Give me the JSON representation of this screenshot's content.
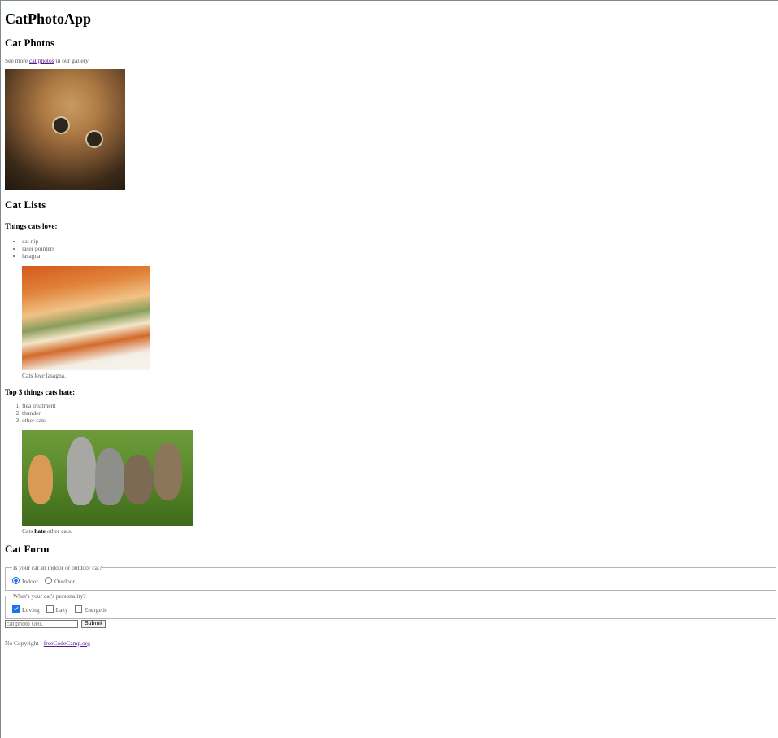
{
  "app": {
    "title": "CatPhotoApp"
  },
  "photos_section": {
    "heading": "Cat Photos",
    "intro_before": "See more ",
    "link_text": "cat photos",
    "intro_after": " in our gallery."
  },
  "lists_section": {
    "heading": "Cat Lists",
    "love_heading": "Things cats love:",
    "love_items": [
      "cat nip",
      "laser pointers",
      "lasagna"
    ],
    "love_caption_before": "Cats ",
    "love_caption_emph": "love",
    "love_caption_after": " lasagna.",
    "hate_heading": "Top 3 things cats hate:",
    "hate_items": [
      "flea treatment",
      "thunder",
      "other cats"
    ],
    "hate_caption_before": "Cats ",
    "hate_caption_strong": "hate",
    "hate_caption_after": " other cats."
  },
  "form_section": {
    "heading": "Cat Form",
    "indoor_legend": "Is your cat an indoor or outdoor cat?",
    "indoor_label": "Indoor",
    "outdoor_label": "Outdoor",
    "personality_legend": "What's your cat's personality?",
    "loving_label": "Loving",
    "lazy_label": "Lazy",
    "energetic_label": "Energetic",
    "url_placeholder": "cat photo URL",
    "submit_label": "Submit",
    "selected": {
      "indoor": true,
      "outdoor": false,
      "loving": true,
      "lazy": false,
      "energetic": false
    }
  },
  "footer": {
    "text": "No Copyright - ",
    "link_text": "freeCodeCamp.org"
  },
  "colors": {
    "accent": "#1a73e8",
    "link": "#551a8b"
  },
  "icons": {
    "photos": "cat-photo",
    "lasagna": "lasagna-photo",
    "kittens": "kittens-photo"
  }
}
